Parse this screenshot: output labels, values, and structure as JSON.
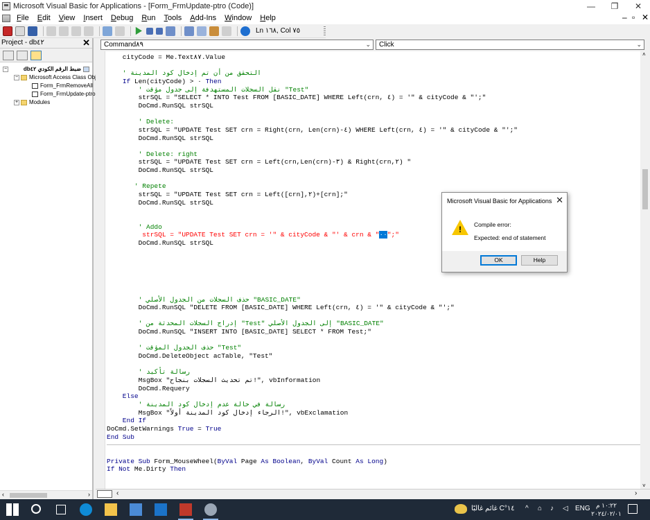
{
  "window": {
    "title": "Microsoft Visual Basic for Applications - [Form_FrmUpdate-ptro (Code)]"
  },
  "menu": [
    "File",
    "Edit",
    "View",
    "Insert",
    "Debug",
    "Run",
    "Tools",
    "Add-Ins",
    "Window",
    "Help"
  ],
  "toolbar": {
    "ln_col": "Ln ١٦٨, Col ٧٥"
  },
  "project": {
    "title": "Project - db٤٢",
    "tree": [
      {
        "label": "ضبط الرقم الكودي db٤٢"
      },
      {
        "label": "Microsoft Access Class Objects"
      },
      {
        "label": "Form_FrmRemoveAll"
      },
      {
        "label": "Form_FrmUpdate-ptro"
      },
      {
        "label": "Modules"
      }
    ]
  },
  "code": {
    "object_combo": "Command٨٩",
    "proc_combo": "Click",
    "lines": [
      {
        "text": "    cityCode = Me.Text٨٧.Value",
        "cls": ""
      },
      {
        "text": "",
        "cls": ""
      },
      {
        "text": "    ' التحقق من أن تم إدخال كود المدينة",
        "cls": "comment"
      },
      {
        "text": "    If Len(cityCode) > ٠ Then",
        "cls": "mixed-if"
      },
      {
        "text": "        ' نقل السجلات المستهدفة إلى جدول مؤقت \"Test\"",
        "cls": "comment"
      },
      {
        "text": "        strSQL = \"SELECT * INTO Test FROM [BASIC_DATE] WHERE Left(crn, ٤) = '\" & cityCode & \"';\"",
        "cls": ""
      },
      {
        "text": "        DoCmd.RunSQL strSQL",
        "cls": ""
      },
      {
        "text": "",
        "cls": ""
      },
      {
        "text": "        ' Delete:",
        "cls": "comment"
      },
      {
        "text": "        strSQL = \"UPDATE Test SET crn = Right(crn, Len(crn)-٤) WHERE Left(crn, ٤) = '\" & cityCode & \"';\"",
        "cls": ""
      },
      {
        "text": "        DoCmd.RunSQL strSQL",
        "cls": ""
      },
      {
        "text": "",
        "cls": ""
      },
      {
        "text": "        ' Delete: right",
        "cls": "comment"
      },
      {
        "text": "        strSQL = \"UPDATE Test SET crn = Left(crn,Len(crn)-٣) & Right(crn,٢) \"",
        "cls": ""
      },
      {
        "text": "        DoCmd.RunSQL strSQL",
        "cls": ""
      },
      {
        "text": "",
        "cls": ""
      },
      {
        "text": "       ' Repete",
        "cls": "comment"
      },
      {
        "text": "        strSQL = \"UPDATE Test SET crn = Left([crn],٢)+[crn];\"",
        "cls": ""
      },
      {
        "text": "        DoCmd.RunSQL strSQL",
        "cls": ""
      },
      {
        "text": "",
        "cls": ""
      },
      {
        "text": "",
        "cls": ""
      },
      {
        "text": "        ' Addo",
        "cls": "comment"
      },
      {
        "text": "         strSQL = \"UPDATE Test SET crn = '\" & cityCode & \"' & crn & \"",
        "cls": "err",
        "sel": "٠٠",
        "after": "\";\""
      },
      {
        "text": "        DoCmd.RunSQL strSQL",
        "cls": ""
      },
      {
        "text": "",
        "cls": ""
      },
      {
        "text": "",
        "cls": ""
      },
      {
        "text": "",
        "cls": ""
      },
      {
        "text": "",
        "cls": ""
      },
      {
        "text": "",
        "cls": ""
      },
      {
        "text": "",
        "cls": ""
      },
      {
        "text": "        ' حذف السجلات من الجدول الأصلي \"BASIC_DATE\"",
        "cls": "comment"
      },
      {
        "text": "        DoCmd.RunSQL \"DELETE FROM [BASIC_DATE] WHERE Left(crn, ٤) = '\" & cityCode & \"';\"",
        "cls": ""
      },
      {
        "text": "",
        "cls": ""
      },
      {
        "text": "        ' إدراج السجلات المحدثة من \"Test\" إلى الجدول الأصلي \"BASIC_DATE\"",
        "cls": "comment"
      },
      {
        "text": "        DoCmd.RunSQL \"INSERT INTO [BASIC_DATE] SELECT * FROM Test;\"",
        "cls": ""
      },
      {
        "text": "",
        "cls": ""
      },
      {
        "text": "        ' حذف الجدول المؤقت \"Test\"",
        "cls": "comment"
      },
      {
        "text": "        DoCmd.DeleteObject acTable, \"Test\"",
        "cls": ""
      },
      {
        "text": "",
        "cls": ""
      },
      {
        "text": "        ' رسالة تأكيد",
        "cls": "comment"
      },
      {
        "text": "        MsgBox \"تم تحديث السجلات بنجاح!\", vbInformation",
        "cls": ""
      },
      {
        "text": "        DoCmd.Requery",
        "cls": ""
      },
      {
        "text": "    Else",
        "cls": "kw"
      },
      {
        "text": "        ' رسالة في حالة عدم إدخال كود المدينة",
        "cls": "comment"
      },
      {
        "text": "        MsgBox \"الرجاء إدخال كود المدينة أولاً!\", vbExclamation",
        "cls": ""
      },
      {
        "text": "    End If",
        "cls": "kw"
      },
      {
        "text": "DoCmd.SetWarnings True = True",
        "cls": "mixed-warn"
      },
      {
        "text": "End Sub",
        "cls": "kw"
      },
      {
        "text": "",
        "cls": "sep"
      },
      {
        "text": "",
        "cls": ""
      },
      {
        "text": "Private Sub Form_MouseWheel(ByVal Page As Boolean, ByVal Count As Long)",
        "cls": "mixed-sub"
      },
      {
        "text": "If Not Me.Dirty Then",
        "cls": "mixed-ifnot"
      }
    ]
  },
  "dialog": {
    "title": "Microsoft Visual Basic for Applications",
    "line1": "Compile error:",
    "line2": "Expected: end of statement",
    "ok": "OK",
    "help": "Help"
  },
  "taskbar": {
    "weather": "١٤°C غائم غالبًا",
    "lang": "ENG",
    "time": "١٠:٢٢ م",
    "date": "٢٠٢٤/٠٢/٠١"
  }
}
